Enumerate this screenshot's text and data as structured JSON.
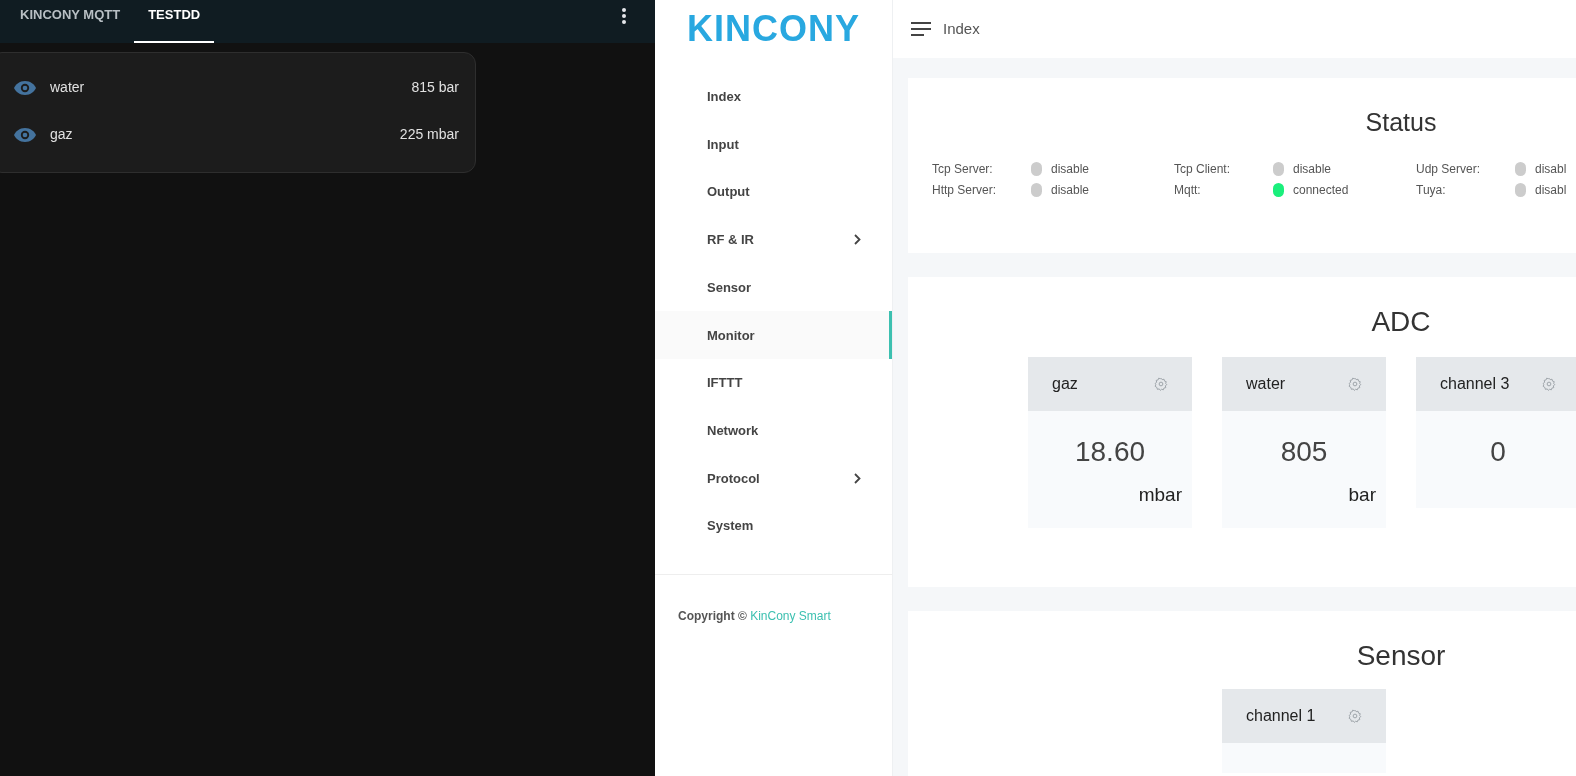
{
  "left_app": {
    "tabs": [
      {
        "label": "KINCONY MQTT",
        "selected": false
      },
      {
        "label": "TESTDD",
        "selected": true
      }
    ],
    "entities": [
      {
        "name": "water",
        "value": "815 bar"
      },
      {
        "name": "gaz",
        "value": "225 mbar"
      }
    ]
  },
  "logo": "KINCONY",
  "header": {
    "title": "Index"
  },
  "sidebar": {
    "items": [
      {
        "label": "Index",
        "selected": false,
        "submenu": false
      },
      {
        "label": "Input",
        "selected": false,
        "submenu": false
      },
      {
        "label": "Output",
        "selected": false,
        "submenu": false
      },
      {
        "label": "RF & IR",
        "selected": false,
        "submenu": true
      },
      {
        "label": "Sensor",
        "selected": false,
        "submenu": false
      },
      {
        "label": "Monitor",
        "selected": true,
        "submenu": false
      },
      {
        "label": "IFTTT",
        "selected": false,
        "submenu": false
      },
      {
        "label": "Network",
        "selected": false,
        "submenu": false
      },
      {
        "label": "Protocol",
        "selected": false,
        "submenu": true
      },
      {
        "label": "System",
        "selected": false,
        "submenu": false
      }
    ],
    "copyright": "Copyright ©",
    "copyright_link": "KinCony Smart"
  },
  "status": {
    "title": "Status",
    "columns": [
      [
        {
          "label": "Tcp Server:",
          "value": "disable",
          "on": false
        },
        {
          "label": "Http Server:",
          "value": "disable",
          "on": false
        }
      ],
      [
        {
          "label": "Tcp Client:",
          "value": "disable",
          "on": false
        },
        {
          "label": "Mqtt:",
          "value": "connected",
          "on": true
        }
      ],
      [
        {
          "label": "Udp Server:",
          "value": "disabl",
          "on": false
        },
        {
          "label": "Tuya:",
          "value": "disabl",
          "on": false
        }
      ]
    ]
  },
  "adc": {
    "title": "ADC",
    "channels": [
      {
        "name": "gaz",
        "value": "18.60",
        "unit": "mbar"
      },
      {
        "name": "water",
        "value": "805",
        "unit": "bar"
      },
      {
        "name": "channel 3",
        "value": "0"
      }
    ]
  },
  "sensor": {
    "title": "Sensor",
    "channels": [
      {
        "name": "channel 1"
      }
    ]
  }
}
